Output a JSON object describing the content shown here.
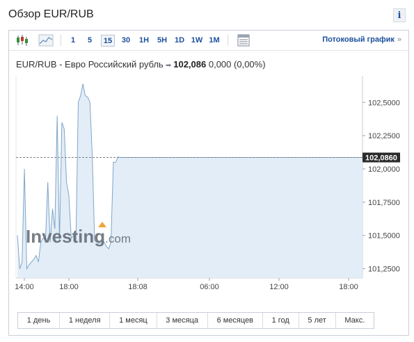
{
  "header": {
    "title": "Обзор EUR/RUB",
    "info_label": "i"
  },
  "toolbar": {
    "icons": [
      "candlestick-icon",
      "area-chart-icon",
      "table-icon"
    ],
    "timeframes": [
      {
        "label": "1",
        "active": false
      },
      {
        "label": "5",
        "active": false
      },
      {
        "label": "15",
        "active": true
      },
      {
        "label": "30",
        "active": false
      },
      {
        "label": "1H",
        "active": false
      },
      {
        "label": "5H",
        "active": false
      },
      {
        "label": "1D",
        "active": false
      },
      {
        "label": "1W",
        "active": false
      },
      {
        "label": "1M",
        "active": false
      }
    ],
    "stream_label": "Потоковый график",
    "stream_arrow": "»"
  },
  "quote": {
    "name": "EUR/RUB - Евро Российский рубль",
    "price": "102,086",
    "change": "0,000",
    "change_pct": "(0,00%)"
  },
  "watermark": {
    "text_main": "Investing",
    "text_suffix": ".com"
  },
  "chart_data": {
    "type": "area",
    "x_ticks": [
      "14:00",
      "18:00",
      "18:08",
      "06:00",
      "12:00",
      "18:00"
    ],
    "y_ticks": [
      "102,5000",
      "102,2500",
      "102,0000",
      "101,7500",
      "101,5000",
      "101,2500"
    ],
    "y_tick_values": [
      102.5,
      102.25,
      102.0,
      101.75,
      101.5,
      101.25
    ],
    "ylim": [
      101.18,
      102.7
    ],
    "current_label": "102,0860",
    "current_value": 102.086,
    "values": [
      101.5,
      101.25,
      101.3,
      102.0,
      101.25,
      101.28,
      101.3,
      101.32,
      101.35,
      101.3,
      101.45,
      101.48,
      101.47,
      101.9,
      101.45,
      101.7,
      101.55,
      102.4,
      101.45,
      102.35,
      102.3,
      101.9,
      101.8,
      101.48,
      101.5,
      101.45,
      102.5,
      102.55,
      102.64,
      102.55,
      102.54,
      102.5,
      102.1,
      101.46,
      101.45,
      101.44,
      101.46,
      101.45,
      101.42,
      101.4,
      101.45,
      102.05,
      102.05,
      102.09,
      102.086
    ],
    "flat_to_end": true,
    "colors": {
      "line": "#7ea6c9",
      "fill": "#e3edf7",
      "current_box": "#2b2b2b"
    }
  },
  "ranges": [
    "1 день",
    "1 неделя",
    "1 месяц",
    "3 месяца",
    "6 месяцев",
    "1 год",
    "5 лет",
    "Макс."
  ]
}
